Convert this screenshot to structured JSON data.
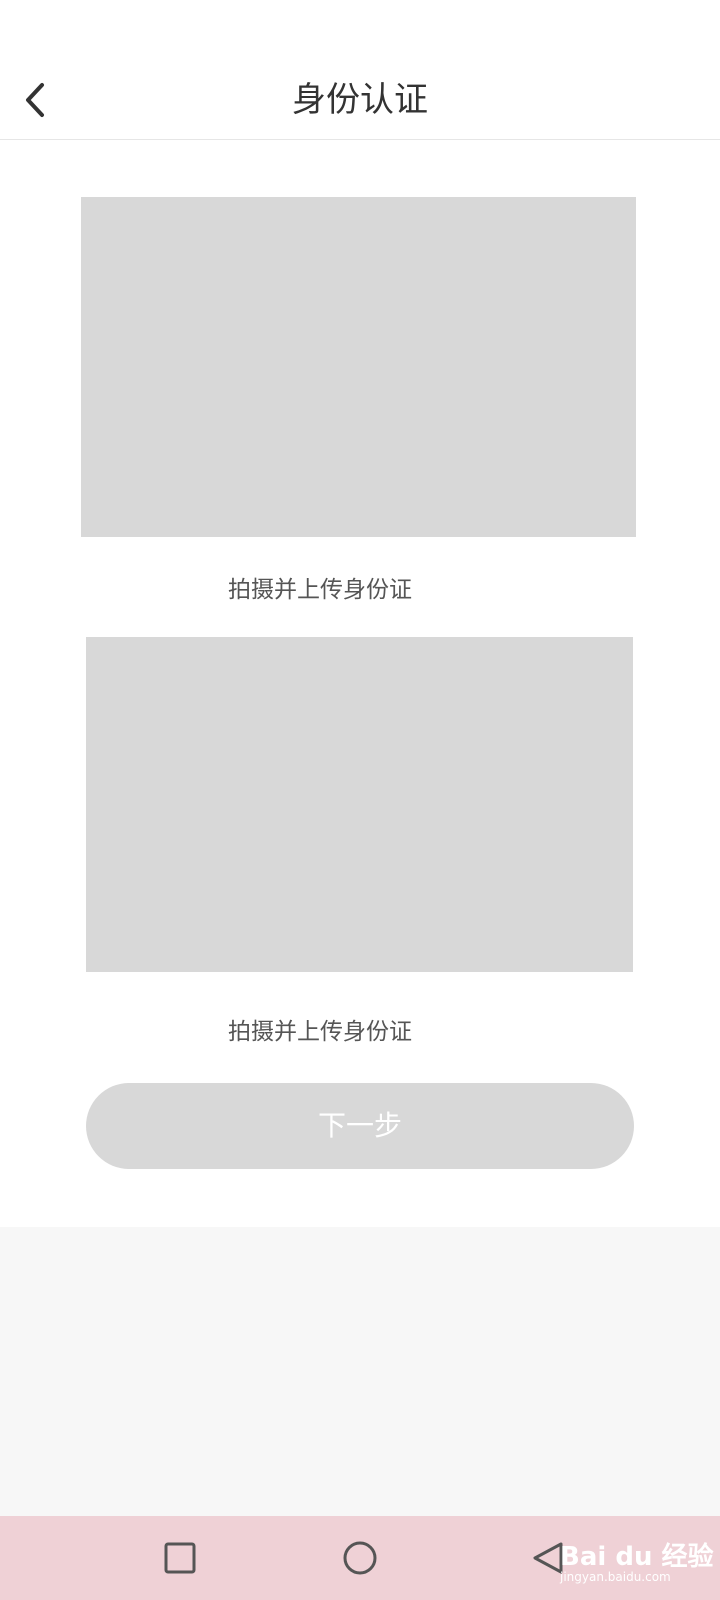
{
  "header": {
    "title": "身份认证"
  },
  "id_front": {
    "label": "拍摄并上传身份证"
  },
  "id_back": {
    "label": "拍摄并上传身份证"
  },
  "next_button": {
    "label": "下一步"
  },
  "watermark": {
    "brand": "Bai du 经验",
    "url": "jingyan.baidu.com"
  },
  "colors": {
    "placeholder": "#d8d8d8",
    "nav_bar": "#efd1d6",
    "background": "#f7f7f7"
  }
}
